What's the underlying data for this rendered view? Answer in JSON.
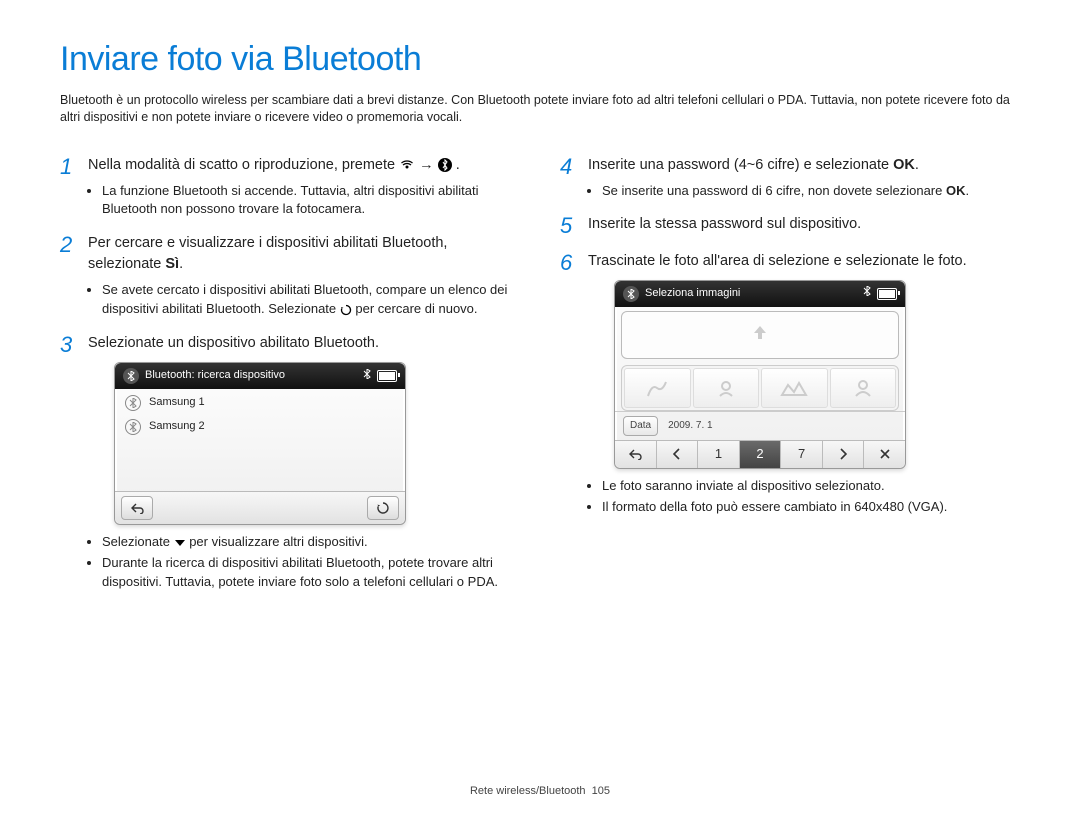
{
  "page_title": "Inviare foto via Bluetooth",
  "intro": "Bluetooth è un protocollo wireless per scambiare dati a brevi distanze. Con Bluetooth potete inviare foto ad altri telefoni cellulari o PDA. Tuttavia, non potete ricevere foto da altri dispositivi e non potete inviare o ricevere video o promemoria vocali.",
  "steps": {
    "s1": {
      "num": "1",
      "body_pre": "Nella modalità di scatto o riproduzione, premete ",
      "body_post": ".",
      "arrow_text": "→",
      "bullets": [
        "La funzione Bluetooth si accende. Tuttavia, altri dispositivi abilitati Bluetooth non possono trovare la fotocamera."
      ]
    },
    "s2": {
      "num": "2",
      "body_pre": "Per cercare e visualizzare i dispositivi abilitati Bluetooth, selezionate ",
      "body_bold": "Sì",
      "body_post": ".",
      "bullets_pre": "Se avete cercato i dispositivi abilitati Bluetooth, compare un elenco dei dispositivi abilitati Bluetooth. Selezionate ",
      "bullets_post": " per cercare di nuovo."
    },
    "s3": {
      "num": "3",
      "body": "Selezionate un dispositivo abilitato Bluetooth.",
      "bullets_pre1": "Selezionate ",
      "bullets_post1": " per visualizzare altri dispositivi.",
      "bullets2": "Durante la ricerca di dispositivi abilitati Bluetooth, potete trovare altri dispositivi. Tuttavia, potete inviare foto solo a telefoni cellulari o PDA."
    },
    "s4": {
      "num": "4",
      "body_pre": "Inserite una password (4~6 cifre) e selezionate ",
      "body_bold": "OK",
      "body_post": ".",
      "bullets_pre": "Se inserite una password di 6 cifre, non dovete selezionare ",
      "bullets_bold": "OK",
      "bullets_post": "."
    },
    "s5": {
      "num": "5",
      "body": "Inserite la stessa password sul dispositivo."
    },
    "s6": {
      "num": "6",
      "body": "Trascinate le foto all'area di selezione e selezionate le foto.",
      "bullets": [
        "Le foto saranno inviate al dispositivo selezionato.",
        "Il formato della foto può essere cambiato in 640x480 (VGA)."
      ]
    }
  },
  "mock1": {
    "status": "Bluetooth: ricerca dispositivo",
    "items": [
      "Samsung 1",
      "Samsung 2"
    ]
  },
  "mock2": {
    "status": "Seleziona immagini",
    "data_label": "Data",
    "date": "2009. 7. 1",
    "pages": [
      "⮐",
      "‹",
      "1",
      "2",
      "7",
      "›",
      "✕"
    ]
  },
  "footer_section": "Rete wireless/Bluetooth",
  "footer_page": "105"
}
